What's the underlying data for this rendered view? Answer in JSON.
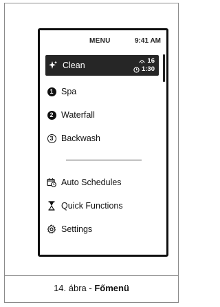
{
  "status_bar": {
    "title": "MENU",
    "time": "9:41 AM"
  },
  "menu": {
    "items": [
      {
        "label": "Clean",
        "icon": "sparkle-icon",
        "selected": true
      },
      {
        "label": "Spa",
        "icon": "number-1-icon",
        "badge": "1"
      },
      {
        "label": "Waterfall",
        "icon": "number-2-icon",
        "badge": "2"
      },
      {
        "label": "Backwash",
        "icon": "number-3-icon",
        "badge": "3"
      }
    ],
    "secondary_items": [
      {
        "label": "Auto Schedules",
        "icon": "calendar-clock-icon"
      },
      {
        "label": "Quick Functions",
        "icon": "hourglass-icon"
      },
      {
        "label": "Settings",
        "icon": "gear-icon"
      }
    ]
  },
  "clean_meta": {
    "speed": "16",
    "duration": "1:30"
  },
  "caption": {
    "prefix": "14. ábra - ",
    "title": "Főmenü"
  }
}
